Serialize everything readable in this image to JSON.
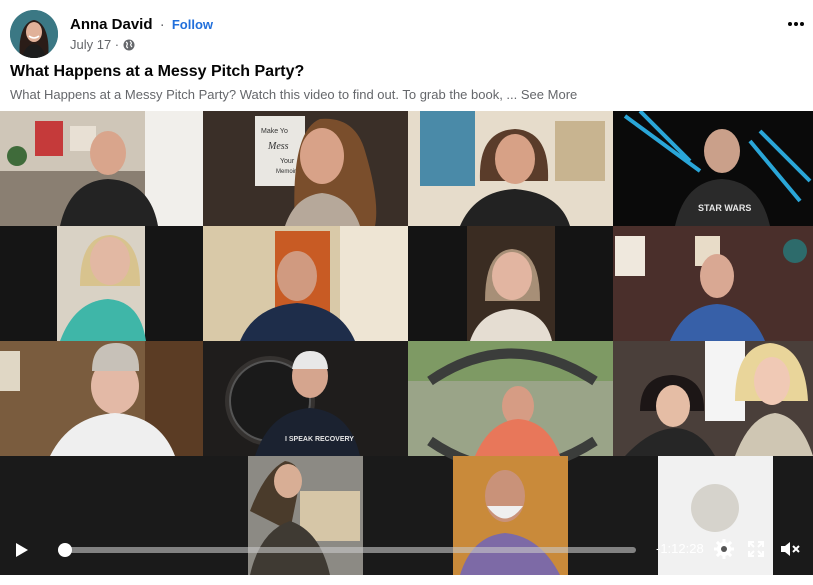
{
  "post": {
    "author": "Anna David",
    "separator": "·",
    "follow_label": "Follow",
    "date": "July 17 ·",
    "privacy_icon": "globe-icon",
    "more_icon": "more-options-icon",
    "title": "What Happens at a Messy Pitch Party?",
    "description": "What Happens at a Messy Pitch Party? Watch this video to find out. To grab the book, ...",
    "see_more_label": "See More"
  },
  "video": {
    "participant_count": 19,
    "poster_text": {
      "book_line1": "Make Yo",
      "book_line2": "Mess",
      "book_line3": "Your",
      "book_line4": "Memoir",
      "shirt1": "STAR WARS",
      "shirt2": "I SPEAK RECOVERY"
    }
  },
  "player": {
    "progress": 0,
    "time_remaining": "-1:12:28",
    "play_icon": "play-icon",
    "settings_icon": "gear-icon",
    "fullscreen_icon": "fullscreen-icon",
    "mute_icon": "muted-speaker-icon"
  },
  "colors": {
    "follow": "#216fdb",
    "secondary_text": "#65676b",
    "video_background": "#1a1a1a"
  }
}
